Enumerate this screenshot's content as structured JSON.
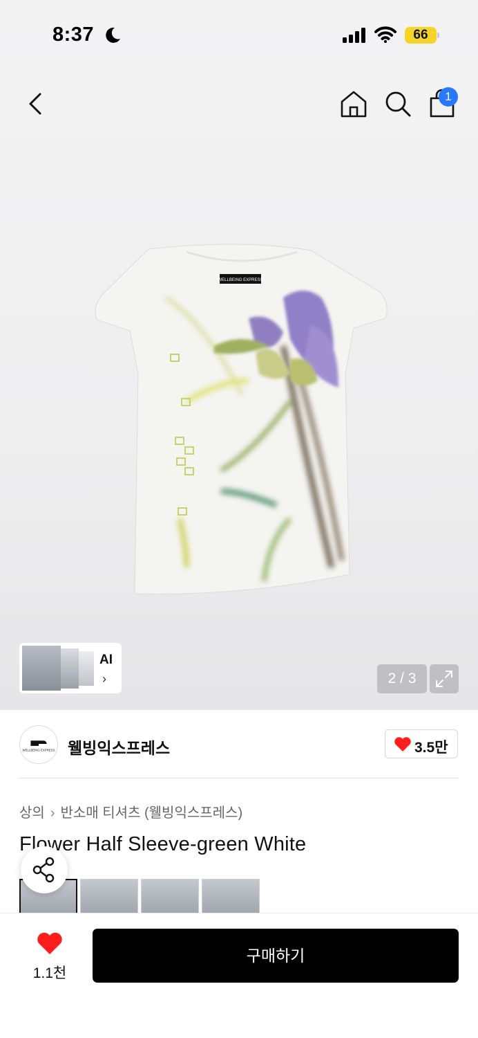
{
  "status_bar": {
    "time": "8:37",
    "battery": "66"
  },
  "nav": {
    "cart_count": "1"
  },
  "gallery": {
    "ai_label": "AI",
    "pager": "2 / 3"
  },
  "brand": {
    "name": "웰빙익스프레스",
    "logo_text": "WELLBEING EXPRESS",
    "likes": "3.5만"
  },
  "breadcrumb": {
    "level1": "상의",
    "level2": "반소매 티셔츠 (웰빙익스프레스)"
  },
  "product": {
    "title": "Flower Half Sleeve-green White",
    "label_text": "WELLBEING EXPRESS"
  },
  "bottom": {
    "fav_count": "1.1천",
    "buy_label": "구매하기"
  },
  "colors": {
    "accent_badge": "#2979ff",
    "heart": "#ff1e1e",
    "battery": "#f5d42a",
    "buy_button": "#000000"
  }
}
